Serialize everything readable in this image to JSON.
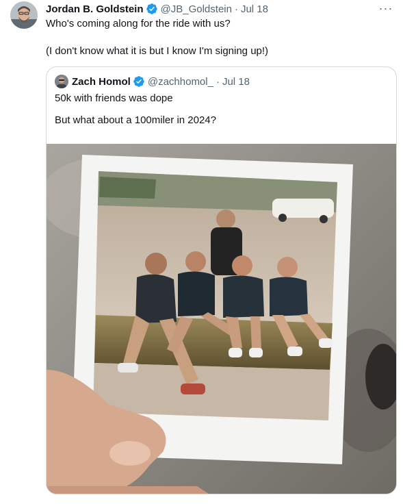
{
  "tweet": {
    "author_name": "Jordan B. Goldstein",
    "author_handle": "@JB_Goldstein",
    "separator": "·",
    "date": "Jul 18",
    "more_label": "···",
    "text_line1": "Who's coming along for the ride with us?",
    "text_line2": "(I don't know what it is but I know I'm signing up!)",
    "verified_icon": "verified-badge-icon",
    "more_icon": "more-options-icon"
  },
  "quote": {
    "author_name": "Zach Homol",
    "author_handle": "@zachhomol_",
    "separator": "·",
    "date": "Jul 18",
    "text_line1": "50k with friends was dope",
    "text_line2": "But what about a 100miler in 2024?",
    "image_description_icon": "photo-icon"
  },
  "colors": {
    "text_primary": "#0f1419",
    "text_secondary": "#536471",
    "verified_blue": "#1d9bf0",
    "border": "#cfd9de"
  }
}
